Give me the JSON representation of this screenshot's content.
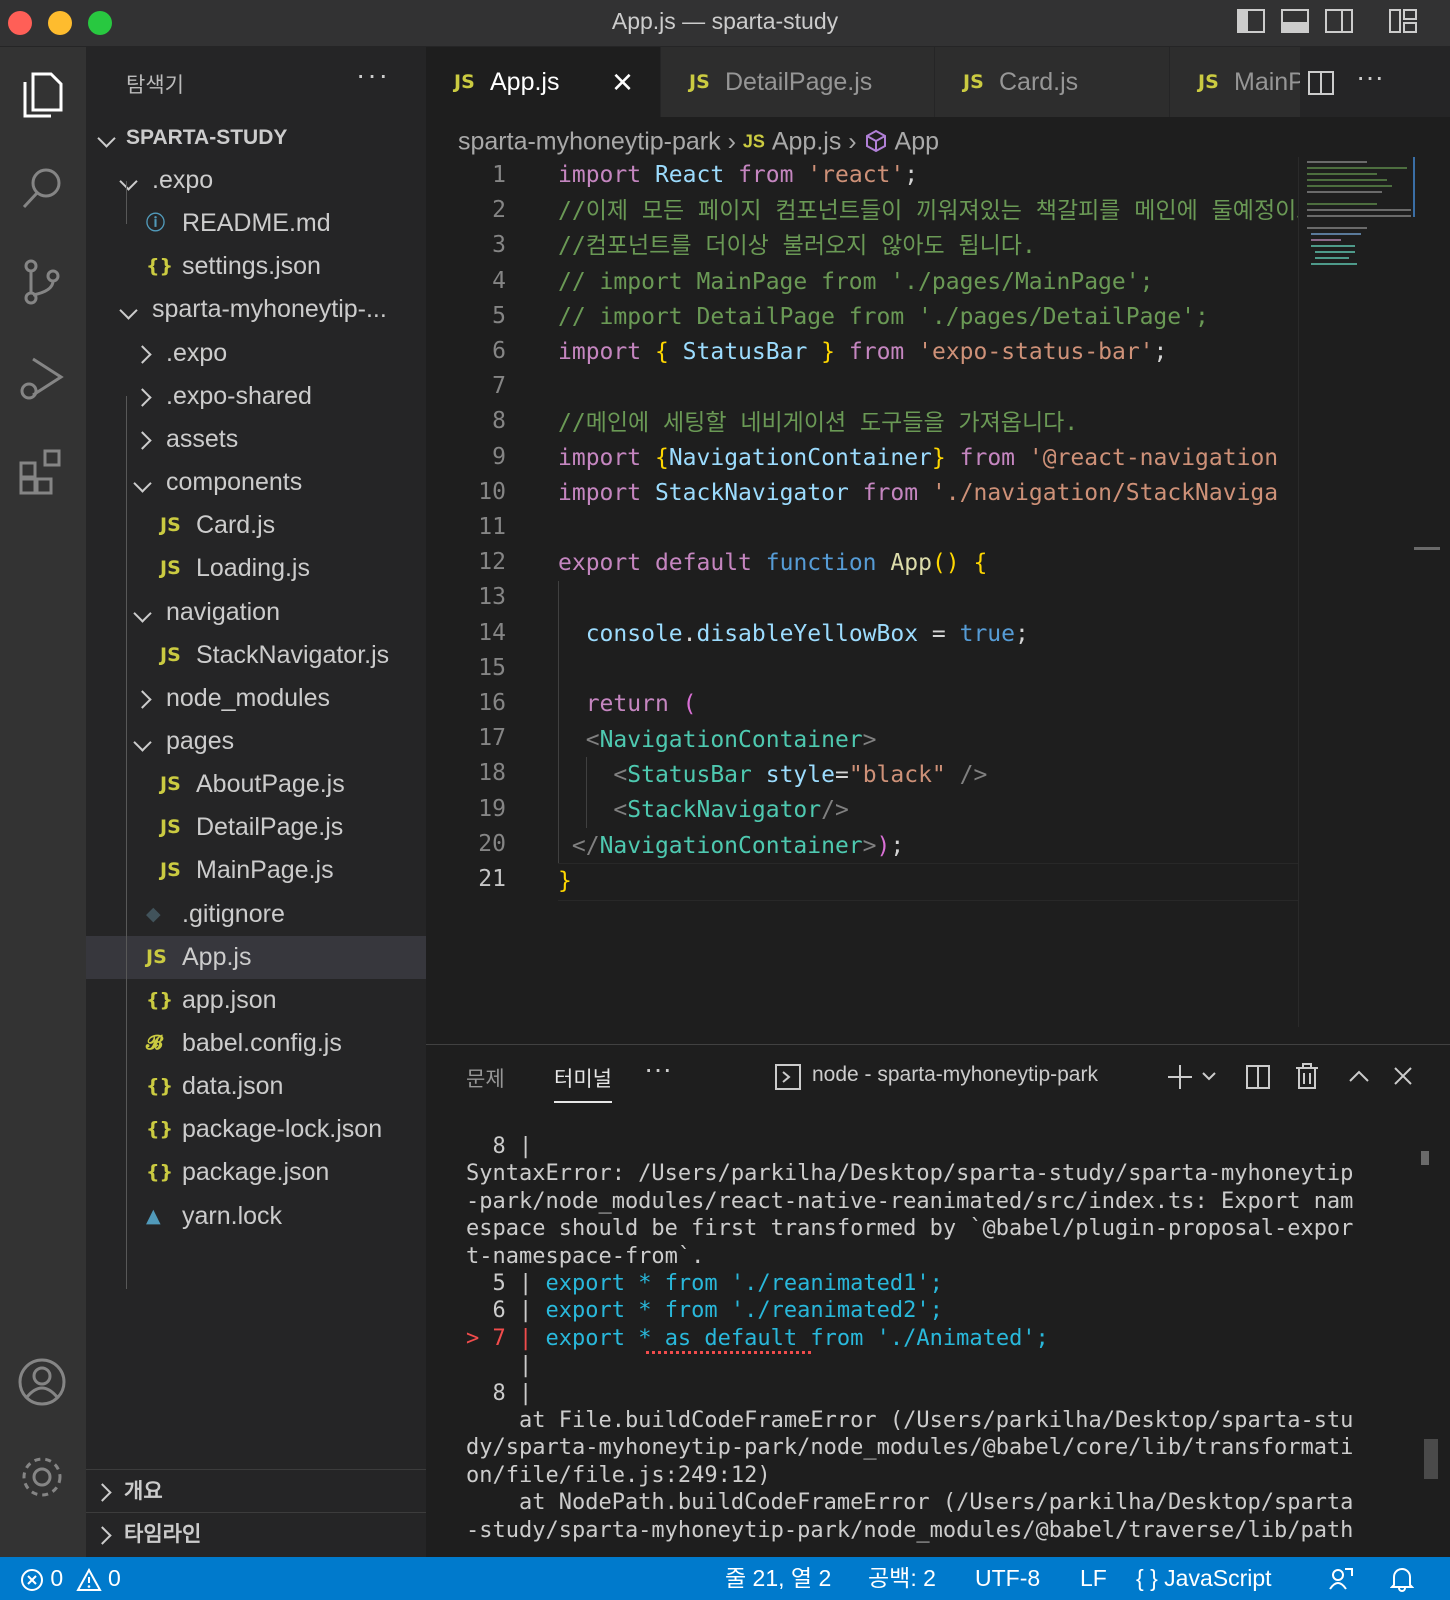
{
  "window": {
    "title": "App.js — sparta-study"
  },
  "sidebar": {
    "title": "탐색기",
    "more": "···",
    "root": "SPARTA-STUDY",
    "tree": [
      {
        "label": ".expo",
        "type": "folder-open",
        "icon": ""
      },
      {
        "label": "README.md",
        "type": "file",
        "icon": "ⓘ"
      },
      {
        "label": "settings.json",
        "type": "file",
        "icon": "{}"
      },
      {
        "label": "sparta-myhoneytip-...",
        "type": "folder-open",
        "icon": ""
      },
      {
        "label": ".expo",
        "type": "folder-closed",
        "icon": ""
      },
      {
        "label": ".expo-shared",
        "type": "folder-closed",
        "icon": ""
      },
      {
        "label": "assets",
        "type": "folder-closed",
        "icon": ""
      },
      {
        "label": "components",
        "type": "folder-open",
        "icon": ""
      },
      {
        "label": "Card.js",
        "type": "file",
        "icon": "JS"
      },
      {
        "label": "Loading.js",
        "type": "file",
        "icon": "JS"
      },
      {
        "label": "navigation",
        "type": "folder-open",
        "icon": ""
      },
      {
        "label": "StackNavigator.js",
        "type": "file",
        "icon": "JS"
      },
      {
        "label": "node_modules",
        "type": "folder-closed",
        "icon": ""
      },
      {
        "label": "pages",
        "type": "folder-open",
        "icon": ""
      },
      {
        "label": "AboutPage.js",
        "type": "file",
        "icon": "JS"
      },
      {
        "label": "DetailPage.js",
        "type": "file",
        "icon": "JS"
      },
      {
        "label": "MainPage.js",
        "type": "file",
        "icon": "JS"
      },
      {
        "label": ".gitignore",
        "type": "file",
        "icon": "◆"
      },
      {
        "label": "App.js",
        "type": "file",
        "icon": "JS",
        "selected": true
      },
      {
        "label": "app.json",
        "type": "file",
        "icon": "{}"
      },
      {
        "label": "babel.config.js",
        "type": "file",
        "icon": "𝓑"
      },
      {
        "label": "data.json",
        "type": "file",
        "icon": "{}"
      },
      {
        "label": "package-lock.json",
        "type": "file",
        "icon": "{}"
      },
      {
        "label": "package.json",
        "type": "file",
        "icon": "{}"
      },
      {
        "label": "yarn.lock",
        "type": "file",
        "icon": "▲"
      }
    ],
    "sections": [
      "개요",
      "타임라인"
    ]
  },
  "tabs": [
    {
      "label": "App.js",
      "icon": "JS",
      "active": true
    },
    {
      "label": "DetailPage.js",
      "icon": "JS"
    },
    {
      "label": "Card.js",
      "icon": "JS"
    },
    {
      "label": "MainPage.js",
      "icon": "JS"
    }
  ],
  "tab_close": "×",
  "breadcrumb": {
    "folder": "sparta-myhoneytip-park",
    "file": "App.js",
    "symbol": "App",
    "file_icon": "JS"
  },
  "editor": {
    "current_line": 21,
    "lines": [
      "1",
      "2",
      "3",
      "4",
      "5",
      "6",
      "7",
      "8",
      "9",
      "10",
      "11",
      "12",
      "13",
      "14",
      "15",
      "16",
      "17",
      "18",
      "19",
      "20",
      "21"
    ]
  },
  "panel": {
    "tabs": [
      "문제",
      "터미널"
    ],
    "active_tab": "터미널",
    "more": "···",
    "terminal_name": "node - sparta-myhoneytip-park",
    "terminal_lines": [
      "  8 |",
      "SyntaxError: /Users/parkilha/Desktop/sparta-study/sparta-myhoneytip",
      "-park/node_modules/react-native-reanimated/src/index.ts: Export nam",
      "espace should be first transformed by `@babel/plugin-proposal-expor",
      "t-namespace-from`.",
      "  5 | export * from './reanimated1';",
      "  6 | export * from './reanimated2';",
      "> 7 | export * as default from './Animated';",
      "    |",
      "  8 |",
      "    at File.buildCodeFrameError (/Users/parkilha/Desktop/sparta-stu",
      "dy/sparta-myhoneytip-park/node_modules/@babel/core/lib/transformati",
      "on/file/file.js:249:12)",
      "    at NodePath.buildCodeFrameError (/Users/parkilha/Desktop/sparta",
      "-study/sparta-myhoneytip-park/node_modules/@babel/traverse/lib/path"
    ]
  },
  "statusbar": {
    "errors": "0",
    "warnings": "0",
    "position": "줄 21, 열 2",
    "indent": "공백: 2",
    "encoding": "UTF-8",
    "eol": "LF",
    "language": "JavaScript",
    "language_icon": "{ }"
  },
  "colors": {
    "accent": "#007acc",
    "js_icon": "#cbcb41",
    "json_icon": "#cbcb41"
  }
}
